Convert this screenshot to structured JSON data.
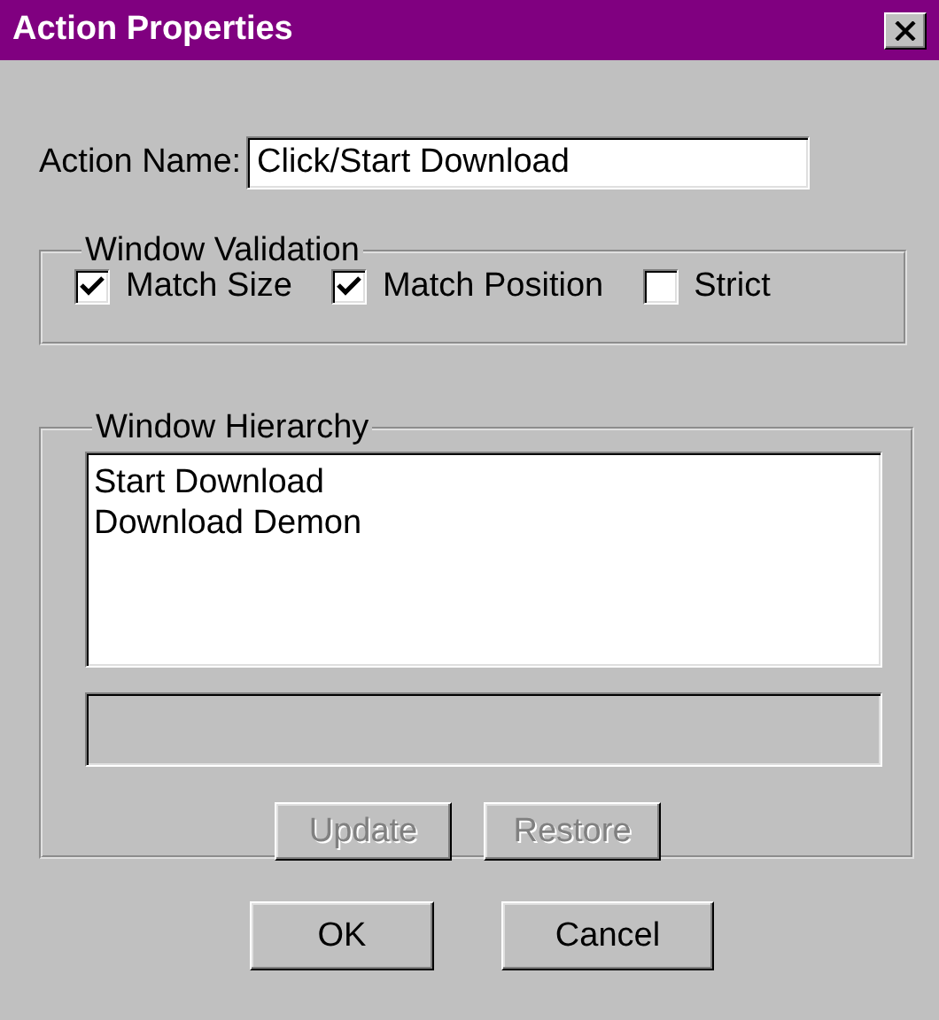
{
  "window": {
    "title": "Action Properties"
  },
  "action_name": {
    "label": "Action Name:",
    "value": "Click/Start Download"
  },
  "window_validation": {
    "title": "Window Validation",
    "options": [
      {
        "label": "Match Size",
        "checked": true
      },
      {
        "label": "Match Position",
        "checked": true
      },
      {
        "label": "Strict",
        "checked": false
      }
    ]
  },
  "window_hierarchy": {
    "title": "Window Hierarchy",
    "items": [
      "Start Download",
      "Download Demon"
    ],
    "detail_field": {
      "disabled": true
    },
    "buttons": [
      {
        "label": "Update",
        "disabled": true
      },
      {
        "label": "Restore",
        "disabled": true
      }
    ]
  },
  "buttons": [
    {
      "label": "OK"
    },
    {
      "label": "Cancel"
    }
  ]
}
